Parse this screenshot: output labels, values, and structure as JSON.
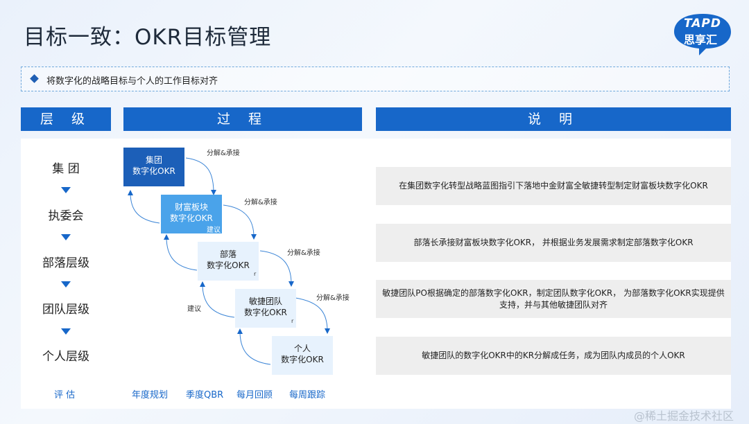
{
  "title": "目标一致：OKR目标管理",
  "logo": {
    "brand": "TAPD",
    "sub": "思享汇"
  },
  "banner": "将数字化的战略目标与个人的工作目标对齐",
  "headers": {
    "level": "层 级",
    "process": "过 程",
    "desc": "说 明"
  },
  "levels": [
    "集 团",
    "执委会",
    "部落层级",
    "团队层级",
    "个人层级"
  ],
  "boxes": [
    {
      "line1": "集团",
      "line2": "数字化OKR"
    },
    {
      "line1": "财富板块",
      "line2": "数字化OKR"
    },
    {
      "line1": "部落",
      "line2": "数字化OKR"
    },
    {
      "line1": "敏捷团队",
      "line2": "数字化OKR"
    },
    {
      "line1": "个人",
      "line2": "数字化OKR"
    }
  ],
  "arrow_labels": {
    "decompose": "分解&承接",
    "suggest": "建议",
    "r": "r"
  },
  "descriptions": [
    "在集团数字化转型战略蓝图指引下落地中金财富全敏捷转型制定财富板块数字化OKR",
    "部落长承接财富板块数字化OKR， 并根据业务发展需求制定部落数字化OKR",
    "敏捷团队PO根据确定的部落数字化OKR，制定团队数字化OKR， 为部落数字化OKR实现提供支持，并与其他敏捷团队对齐",
    "敏捷团队的数字化OKR中的KR分解成任务，成为团队内成员的个人OKR"
  ],
  "evaluation": {
    "label": "评 估",
    "items": [
      "年度规划",
      "季度QBR",
      "每月回顾",
      "每周跟踪"
    ]
  },
  "watermark": "@稀土掘金技术社区",
  "colors": {
    "primary": "#1767c9",
    "dark_box": "#1c5fb8",
    "light_box": "#4aa3ea",
    "pale_box": "#e7f2fd"
  }
}
